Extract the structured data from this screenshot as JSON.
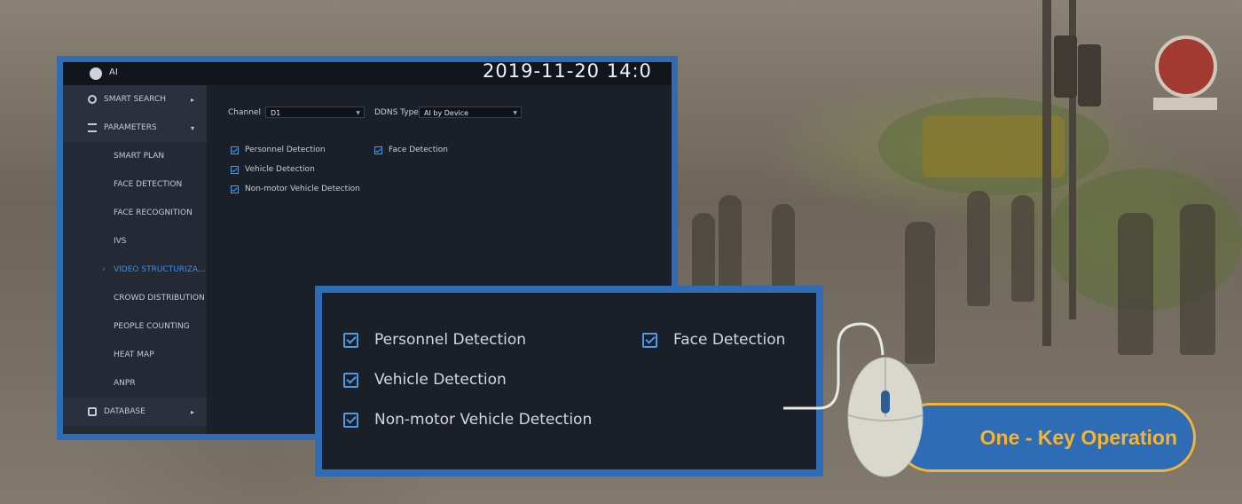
{
  "window": {
    "title": "AI",
    "datetime": "2019-11-20 14:0"
  },
  "sidebar": {
    "items": [
      {
        "label": "SMART SEARCH",
        "type": "top",
        "icon": "search-icon",
        "caret": "▸"
      },
      {
        "label": "PARAMETERS",
        "type": "top",
        "icon": "list-icon",
        "caret": "▾"
      },
      {
        "label": "SMART PLAN",
        "type": "sub"
      },
      {
        "label": "FACE DETECTION",
        "type": "sub"
      },
      {
        "label": "FACE RECOGNITION",
        "type": "sub"
      },
      {
        "label": "IVS",
        "type": "sub"
      },
      {
        "label": "VIDEO STRUCTURIZA...",
        "type": "sub",
        "active": true
      },
      {
        "label": "CROWD DISTRIBUTION",
        "type": "sub"
      },
      {
        "label": "PEOPLE COUNTING",
        "type": "sub"
      },
      {
        "label": "HEAT MAP",
        "type": "sub"
      },
      {
        "label": "ANPR",
        "type": "sub"
      },
      {
        "label": "DATABASE",
        "type": "top",
        "icon": "database-icon",
        "caret": "▸"
      }
    ],
    "selected_marker": "›"
  },
  "form": {
    "channel_label": "Channel",
    "channel_value": "D1",
    "ddns_label": "DDNS Type",
    "ddns_value": "AI by Device",
    "checkboxes": [
      {
        "label": "Personnel Detection",
        "checked": true
      },
      {
        "label": "Face Detection",
        "checked": true
      },
      {
        "label": "Vehicle Detection",
        "checked": true
      },
      {
        "label": "Non-motor Vehicle Detection",
        "checked": true
      }
    ]
  },
  "callout": {
    "label": "One - Key Operation",
    "accent": "#f5b335",
    "panel_blue": "#2e6cb5"
  }
}
